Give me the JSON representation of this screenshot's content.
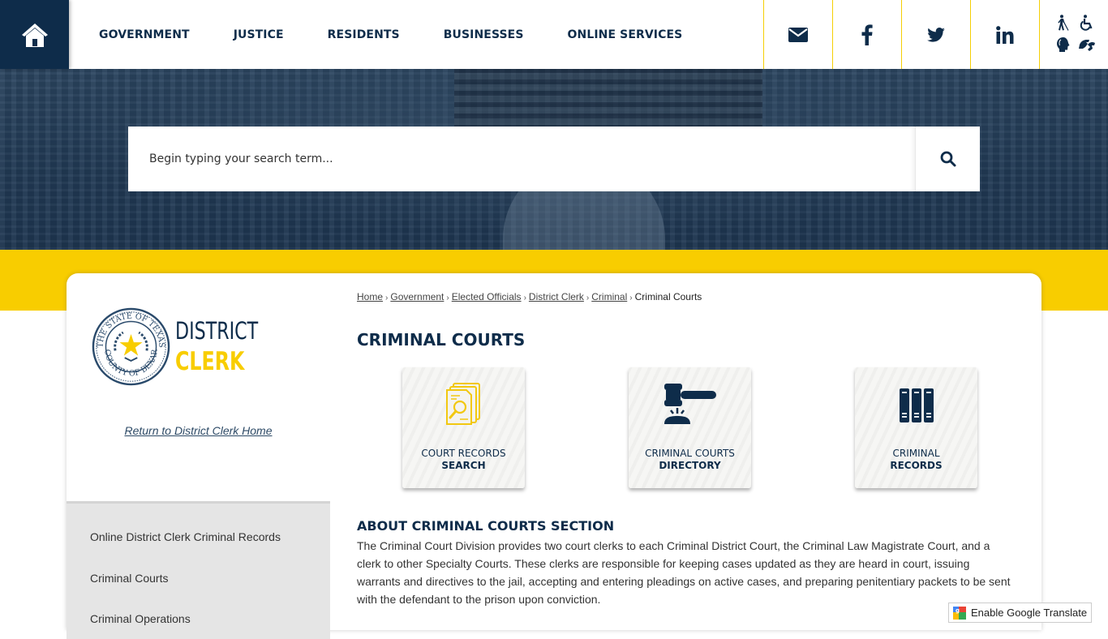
{
  "header": {
    "nav": [
      "GOVERNMENT",
      "JUSTICE",
      "RESIDENTS",
      "BUSINESSES",
      "ONLINE SERVICES"
    ],
    "social": [
      "email-icon",
      "facebook-icon",
      "twitter-icon",
      "linkedin-icon"
    ],
    "accessibility": [
      "blind-walker-icon",
      "wheelchair-icon",
      "hearing-head-icon",
      "sign-language-icon"
    ]
  },
  "search": {
    "placeholder": "Begin typing your search term..."
  },
  "sidebar": {
    "logo": {
      "line1": "DISTRICT",
      "line2": "CLERK",
      "seal_top": "THE STATE OF TEXAS",
      "seal_bottom": "COUNTY OF BEXAR"
    },
    "return_link": "Return to District Clerk Home",
    "items": [
      "Online District Clerk Criminal Records",
      "Criminal Courts",
      "Criminal Operations"
    ]
  },
  "breadcrumb": {
    "links": [
      "Home",
      "Government",
      "Elected Officials",
      "District Clerk",
      "Criminal"
    ],
    "current": "Criminal Courts"
  },
  "page": {
    "title": "CRIMINAL COURTS",
    "tiles": [
      {
        "line1": "COURT RECORDS",
        "line2": "SEARCH",
        "icon": "document-search-icon"
      },
      {
        "line1": "CRIMINAL COURTS",
        "line2": "DIRECTORY",
        "icon": "gavel-icon"
      },
      {
        "line1": "CRIMINAL",
        "line2": "RECORDS",
        "icon": "binders-icon"
      }
    ],
    "about_heading": "ABOUT CRIMINAL COURTS SECTION",
    "about_text": "The Criminal Court Division provides two court clerks to each Criminal District Court, the Criminal Law Magistrate Court, and a clerk to other Specialty Courts. These clerks are responsible for keeping cases updated as they are heard in court, issuing warrants and directives to the jail, accepting and entering pleadings on active cases, and preparing penitentiary packets to be sent with the defendant to the prison upon conviction."
  },
  "translate": {
    "label": "Enable Google Translate"
  },
  "colors": {
    "navy": "#0e2c4a",
    "yellow": "#f8cd00"
  }
}
